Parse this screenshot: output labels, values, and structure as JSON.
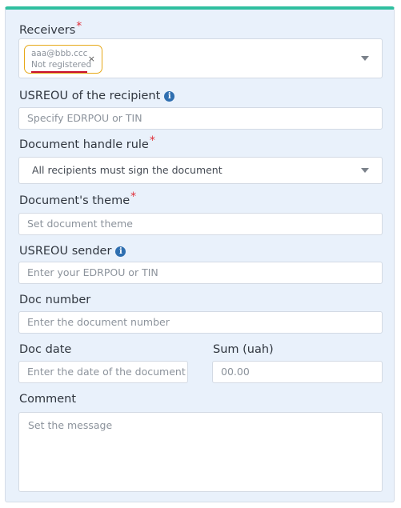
{
  "receivers": {
    "label": "Receivers",
    "required_mark": "*",
    "tag": {
      "email": "aaa@bbb.ccc",
      "status": "Not registered",
      "remove_icon": "×"
    }
  },
  "recipient_usreou": {
    "label": "USREOU of the recipient",
    "info_icon": "i",
    "placeholder": "Specify EDRPOU or TIN"
  },
  "handle_rule": {
    "label": "Document handle rule",
    "required_mark": "*",
    "value": "All recipients must sign the document"
  },
  "theme": {
    "label": "Document's theme",
    "required_mark": "*",
    "placeholder": "Set document theme"
  },
  "sender_usreou": {
    "label": "USREOU sender",
    "info_icon": "i",
    "placeholder": "Enter your EDRPOU or TIN"
  },
  "doc_number": {
    "label": "Doc number",
    "placeholder": "Enter the document number"
  },
  "doc_date": {
    "label": "Doc date",
    "placeholder": "Enter the date of the document"
  },
  "sum": {
    "label": "Sum (uah)",
    "placeholder": "00.00"
  },
  "comment": {
    "label": "Comment",
    "placeholder": "Set the message"
  },
  "colors": {
    "accent": "#2fbf9f",
    "required": "#e0303a",
    "tag_border": "#e6a817",
    "error_underline": "#c8102e",
    "info": "#2f6fb0"
  }
}
